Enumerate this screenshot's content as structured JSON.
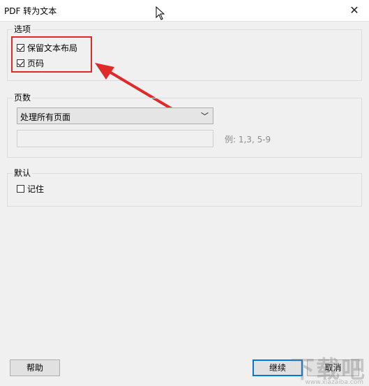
{
  "window": {
    "title": "PDF 转为文本",
    "close_glyph": "✕"
  },
  "options": {
    "label": "选项",
    "preserve_layout": {
      "label": "保留文本布局",
      "checked": true
    },
    "page_numbers": {
      "label": "页码",
      "checked": true
    }
  },
  "pages": {
    "label": "页数",
    "select_value": "处理所有页面",
    "range_value": "",
    "example": "例: 1,3, 5-9"
  },
  "defaults": {
    "label": "默认",
    "remember": {
      "label": "记住",
      "checked": false
    }
  },
  "buttons": {
    "help": "帮助",
    "continue": "继续",
    "cancel": "取消"
  },
  "watermark": {
    "text": "下载吧",
    "sub": "www.xiazaiba.com"
  },
  "colors": {
    "highlight": "#e02a2a",
    "primary_border": "#0078d7"
  }
}
